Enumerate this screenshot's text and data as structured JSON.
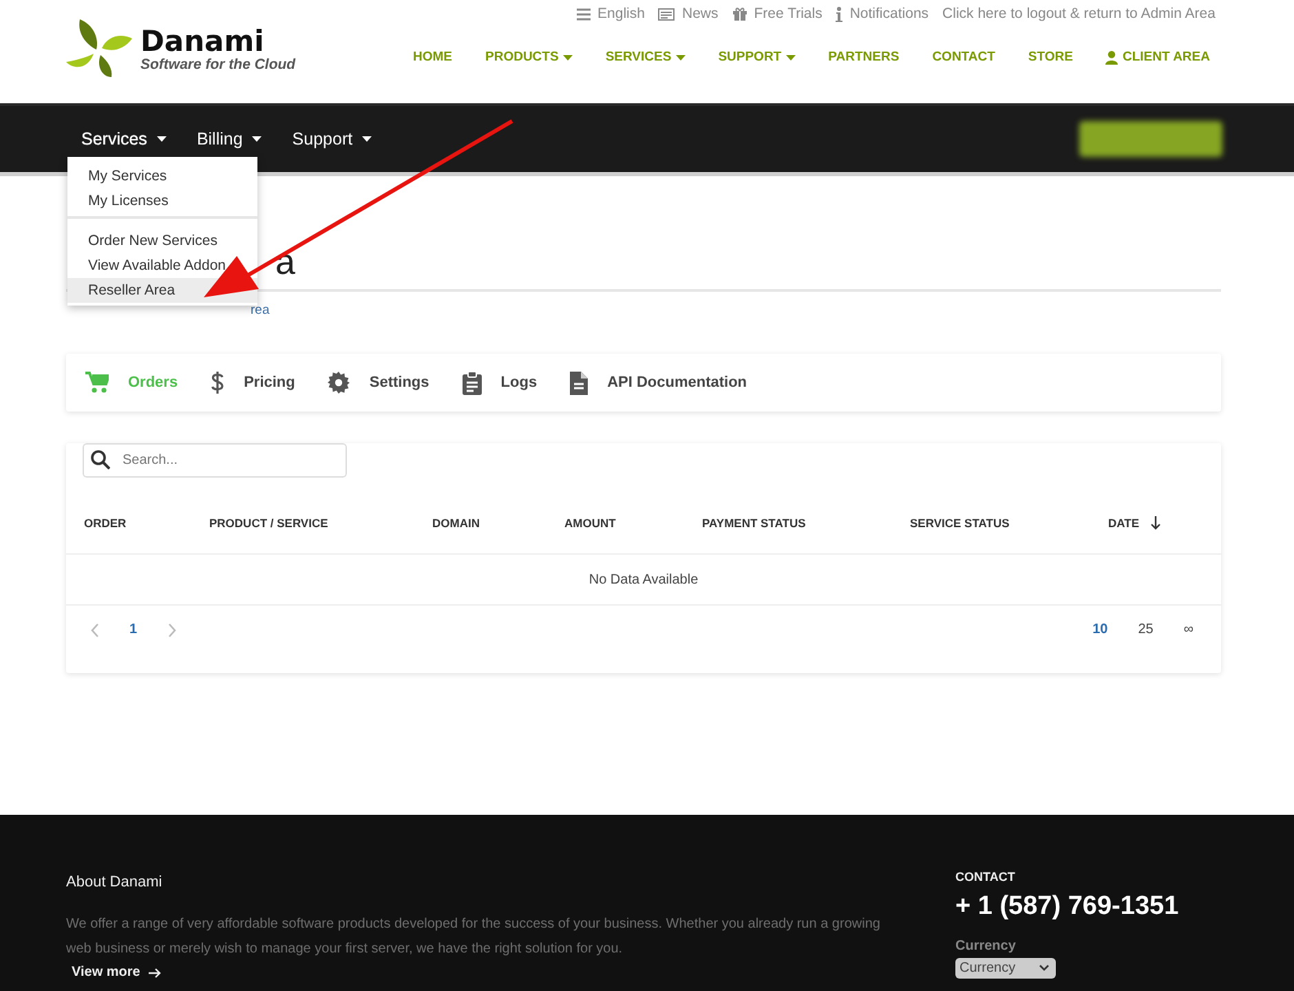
{
  "top_links": [
    "English",
    "News",
    "Free Trials",
    "Notifications",
    "Click here to logout & return to Admin Area"
  ],
  "logo": {
    "name": "Danami",
    "tagline": "Software for the Cloud"
  },
  "main_nav": [
    {
      "label": "HOME",
      "dropdown": false,
      "kind": "link"
    },
    {
      "label": "PRODUCTS",
      "dropdown": true,
      "kind": "link"
    },
    {
      "label": "SERVICES",
      "dropdown": true,
      "kind": "link"
    },
    {
      "label": "SUPPORT",
      "dropdown": true,
      "kind": "link"
    },
    {
      "label": "PARTNERS",
      "dropdown": false,
      "kind": "link"
    },
    {
      "label": "CONTACT",
      "dropdown": false,
      "kind": "link"
    },
    {
      "label": "STORE",
      "dropdown": false,
      "kind": "link"
    },
    {
      "label": "CLIENT AREA",
      "dropdown": false,
      "kind": "account"
    }
  ],
  "client_nav": {
    "items": [
      {
        "label": "Services",
        "expanded": true
      },
      {
        "label": "Billing",
        "expanded": false
      },
      {
        "label": "Support",
        "expanded": false
      }
    ],
    "dropdown_groups": [
      [
        {
          "label": "My Services",
          "selected": false
        },
        {
          "label": "My Licenses",
          "selected": false
        }
      ],
      [
        {
          "label": "Order New Services",
          "selected": false
        },
        {
          "label": "View Available Addon",
          "selected": false
        },
        {
          "label": "Reseller Area",
          "selected": true
        }
      ]
    ]
  },
  "page": {
    "heading_visible": "a",
    "breadcrumb_visible": "rea"
  },
  "tabs": [
    {
      "label": "Orders",
      "selected": true
    },
    {
      "label": "Pricing",
      "selected": false
    },
    {
      "label": "Settings",
      "selected": false
    },
    {
      "label": "Logs",
      "selected": false
    },
    {
      "label": "API Documentation",
      "selected": false
    }
  ],
  "table": {
    "search": {
      "placeholder": "Search..."
    },
    "columns": [
      {
        "label": "ORDER",
        "sorted": false
      },
      {
        "label": "PRODUCT / SERVICE",
        "sorted": false
      },
      {
        "label": "DOMAIN",
        "sorted": false
      },
      {
        "label": "AMOUNT",
        "sorted": false
      },
      {
        "label": "PAYMENT STATUS",
        "sorted": false
      },
      {
        "label": "SERVICE STATUS",
        "sorted": false
      },
      {
        "label": "DATE",
        "sorted": true
      }
    ],
    "empty_message": "No Data Available",
    "pages": [
      {
        "label": "1",
        "selected": true
      }
    ],
    "page_sizes": [
      {
        "label": "10",
        "selected": true
      },
      {
        "label": "25",
        "selected": false
      },
      {
        "label": "∞",
        "selected": false
      }
    ]
  },
  "footer": {
    "about_title": "About Danami",
    "about_text": "We offer a range of very affordable software products developed for the success of your business. Whether you already run a growing web business or merely wish to manage your first server, we have the right solution for you.",
    "view_more": "View more",
    "contact_title": "CONTACT",
    "phone": "+ 1 (587) 769-1351",
    "currency_label": "Currency",
    "currency_value": "Currency"
  }
}
